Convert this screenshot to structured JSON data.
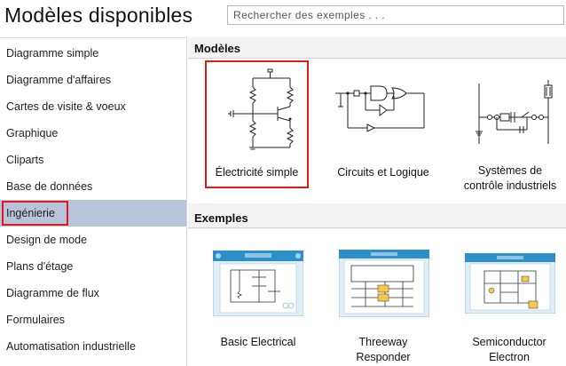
{
  "header": {
    "title": "Modèles disponibles",
    "search_placeholder": "Rechercher des exemples . . ."
  },
  "sidebar": {
    "items": [
      {
        "label": "Diagramme simple"
      },
      {
        "label": "Diagramme d'affaires"
      },
      {
        "label": "Cartes de visite & voeux"
      },
      {
        "label": "Graphique"
      },
      {
        "label": "Cliparts"
      },
      {
        "label": "Base de données"
      },
      {
        "label": "Ingénierie",
        "active": true
      },
      {
        "label": "Design de mode"
      },
      {
        "label": "Plans d'étage"
      },
      {
        "label": "Diagramme de flux"
      },
      {
        "label": "Formulaires"
      },
      {
        "label": "Automatisation industrielle"
      }
    ]
  },
  "templates": {
    "heading": "Modèles",
    "items": [
      {
        "label": "Électricité simple",
        "icon": "electrical-circuit-icon",
        "selected": true
      },
      {
        "label": "Circuits et Logique",
        "icon": "logic-circuit-icon"
      },
      {
        "label_lines": [
          "Systèmes de",
          "contrôle industriels"
        ],
        "icon": "industrial-control-icon"
      }
    ]
  },
  "examples": {
    "heading": "Exemples",
    "items": [
      {
        "label_lines": [
          "Basic Electrical"
        ]
      },
      {
        "label_lines": [
          "Threeway",
          "Responder"
        ]
      },
      {
        "label_lines": [
          "Semiconductor",
          "Electron"
        ]
      }
    ]
  },
  "colors": {
    "selection_border": "#e01b1b",
    "sidebar_active_bg": "#b8c4dc",
    "section_bg": "#f3f3f3",
    "thumb_accent": "#2c8fc8"
  }
}
